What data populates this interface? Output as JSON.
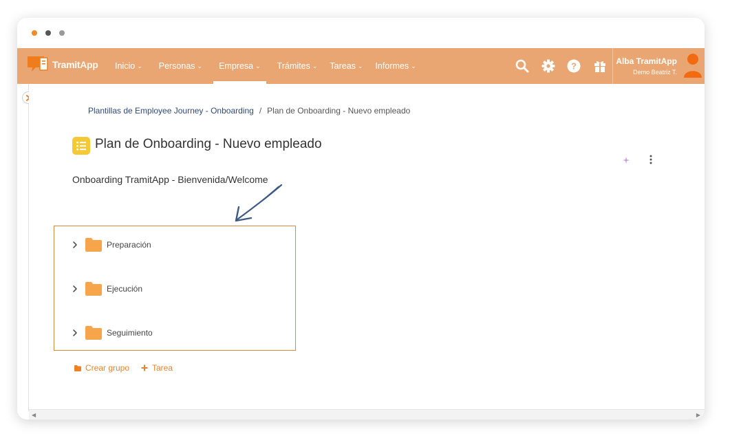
{
  "colors": {
    "navbar": "#eaa672",
    "accent": "#e8822c",
    "folder": "#f7a54a",
    "title_icon": "#f5c936",
    "link": "#2e4a78"
  },
  "window_dots": [
    "#f08b29",
    "#555555",
    "#9a9a9a"
  ],
  "brand": {
    "name_part1": "Tramit",
    "name_part2": "App"
  },
  "nav": {
    "items": [
      {
        "label": "Inicio",
        "active": false
      },
      {
        "label": "Personas",
        "active": false
      },
      {
        "label": "Empresa",
        "active": true
      },
      {
        "label": "Trámites",
        "active": false
      },
      {
        "label": "Tareas",
        "active": false
      },
      {
        "label": "Informes",
        "active": false
      }
    ],
    "icons": [
      "search-icon",
      "gear-icon",
      "help-icon",
      "gift-icon"
    ],
    "user_name": "Alba TramitApp",
    "user_sub": "Demo Beatriz T."
  },
  "breadcrumb": {
    "parent": "Plantillas de Employee Journey - Onboarding",
    "separator": "/",
    "current": "Plan de Onboarding - Nuevo empleado"
  },
  "page": {
    "title": "Plan de Onboarding - Nuevo empleado",
    "subtitle": "Onboarding TramitApp - Bienvenida/Welcome"
  },
  "groups": [
    {
      "label": "Preparación"
    },
    {
      "label": "Ejecución"
    },
    {
      "label": "Seguimiento"
    }
  ],
  "actions": {
    "create_group": "Crear grupo",
    "task": "Tarea"
  }
}
